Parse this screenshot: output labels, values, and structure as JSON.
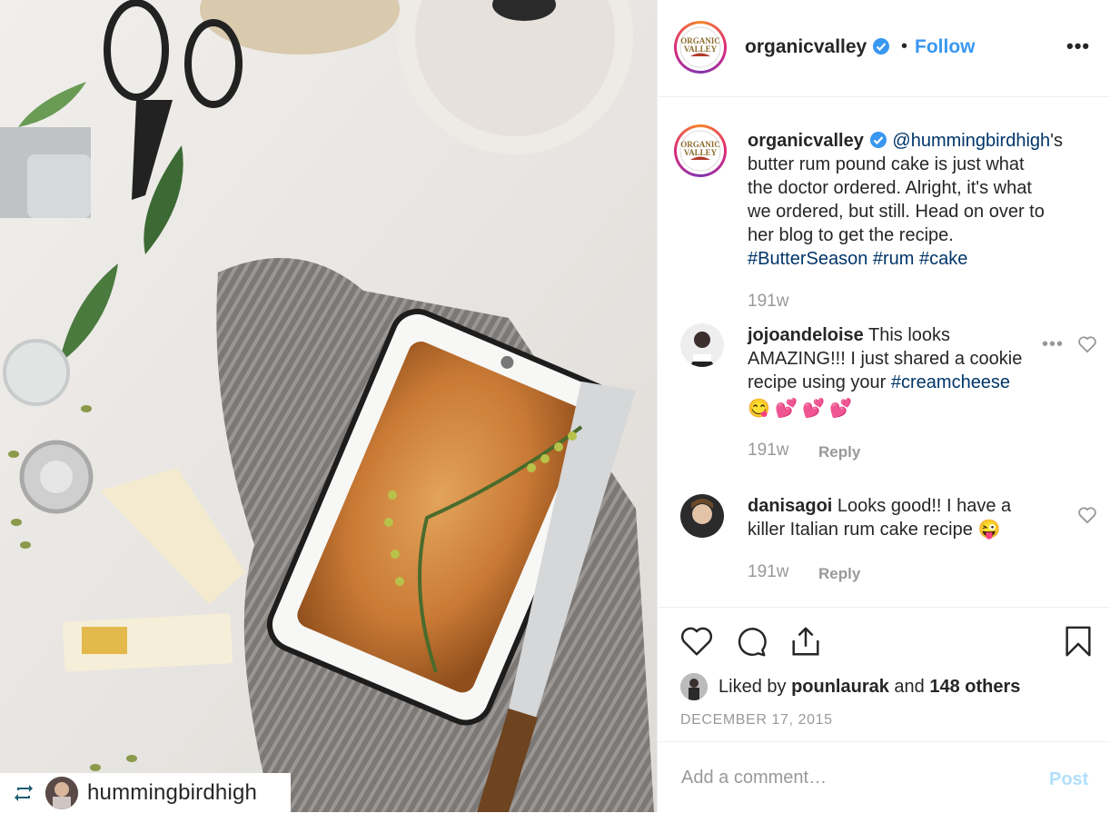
{
  "post": {
    "repost_user": "hummingbirdhigh",
    "brand_colors": {
      "accent": "#3897f0",
      "link": "#003569",
      "muted": "#999999",
      "text": "#262626",
      "post_disabled": "#b2dffc"
    }
  },
  "header": {
    "username": "organicvalley",
    "separator": "•",
    "follow_label": "Follow",
    "more_icon": "more-horizontal-icon",
    "logo_text_1": "ORGANIC",
    "logo_text_2": "VALLEY"
  },
  "caption": {
    "username": "organicvalley",
    "mention": "@hummingbirdhigh",
    "text_line1_tail": "'s",
    "line2": "butter rum pound cake is just what",
    "line3": "the doctor ordered. Alright, it's what",
    "line4": "we ordered, but still. Head on over to",
    "line5": "her blog to get the recipe.",
    "tags": [
      "#ButterSeason",
      "#rum",
      "#cake"
    ],
    "time": "191w"
  },
  "comments": [
    {
      "username": "jojoandeloise",
      "line1_tail": "This looks",
      "line2": "AMAZING!!! I just shared a cookie",
      "line3": "recipe using your",
      "tag": "#creamcheese",
      "emojis": [
        "😋",
        "💕",
        "💕",
        "💕"
      ],
      "time": "191w",
      "reply_label": "Reply"
    },
    {
      "username": "danisagoi",
      "line1_tail": "Looks good!! I have a",
      "line2": "killer Italian rum cake recipe",
      "emoji": "😜",
      "time": "191w",
      "reply_label": "Reply"
    }
  ],
  "actions": {
    "liked_by_prefix": "Liked by",
    "liked_by_user": "pounlaurak",
    "and": "and",
    "others": "148 others",
    "date": "DECEMBER 17, 2015"
  },
  "add_comment": {
    "placeholder": "Add a comment…",
    "post_label": "Post"
  }
}
